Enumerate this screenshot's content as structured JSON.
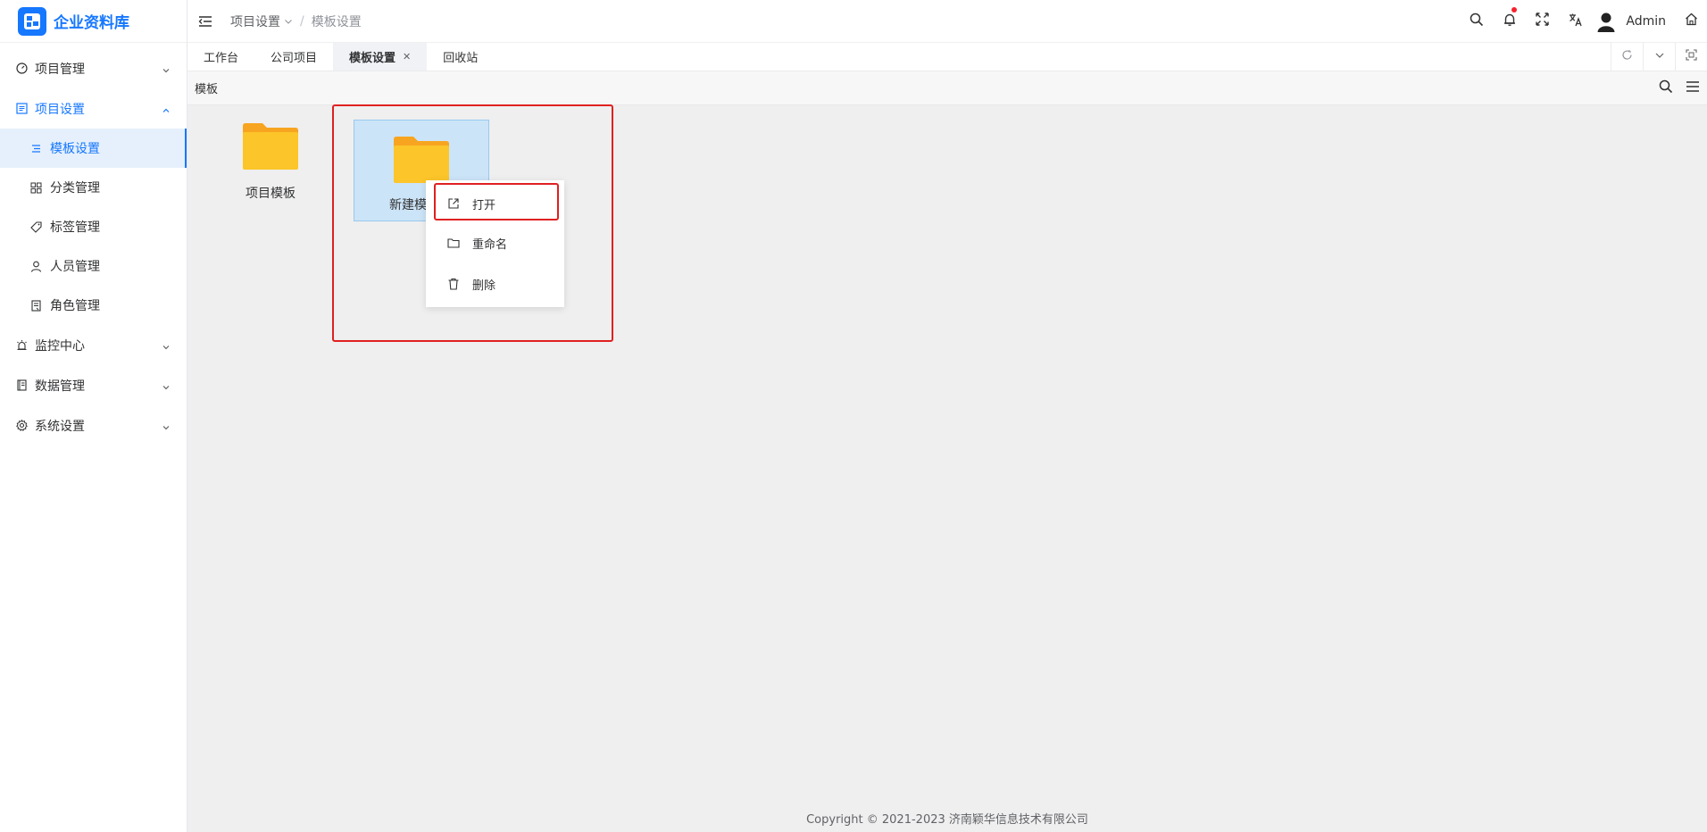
{
  "app": {
    "name": "企业资料库",
    "brand_color": "#1677ff"
  },
  "sidebar": {
    "items": [
      {
        "label": "项目管理",
        "icon": "dashboard-icon"
      },
      {
        "label": "项目设置",
        "icon": "list-icon",
        "expanded": true,
        "children": [
          {
            "label": "模板设置",
            "icon": "menu-lines-icon",
            "active": true
          },
          {
            "label": "分类管理",
            "icon": "grid-icon"
          },
          {
            "label": "标签管理",
            "icon": "tag-icon"
          },
          {
            "label": "人员管理",
            "icon": "user-icon"
          },
          {
            "label": "角色管理",
            "icon": "document-icon"
          }
        ]
      },
      {
        "label": "监控中心",
        "icon": "alarm-icon"
      },
      {
        "label": "数据管理",
        "icon": "book-icon"
      },
      {
        "label": "系统设置",
        "icon": "gear-icon"
      }
    ]
  },
  "header": {
    "breadcrumb": [
      "项目设置",
      "模板设置"
    ],
    "user": "Admin"
  },
  "tabs": [
    {
      "label": "工作台"
    },
    {
      "label": "公司项目"
    },
    {
      "label": "模板设置",
      "active": true,
      "closable": true
    },
    {
      "label": "回收站"
    }
  ],
  "content": {
    "toolbar_title": "模板",
    "folders": [
      {
        "label": "项目模板"
      },
      {
        "label": "新建模",
        "selected": true
      }
    ]
  },
  "context_menu": {
    "items": [
      {
        "label": "打开",
        "icon": "external-link-icon",
        "highlighted": true
      },
      {
        "label": "重命名",
        "icon": "folder-outline-icon"
      },
      {
        "label": "删除",
        "icon": "trash-icon"
      }
    ]
  },
  "footer": {
    "text": "Copyright © 2021-2023 济南颖华信息技术有限公司"
  }
}
